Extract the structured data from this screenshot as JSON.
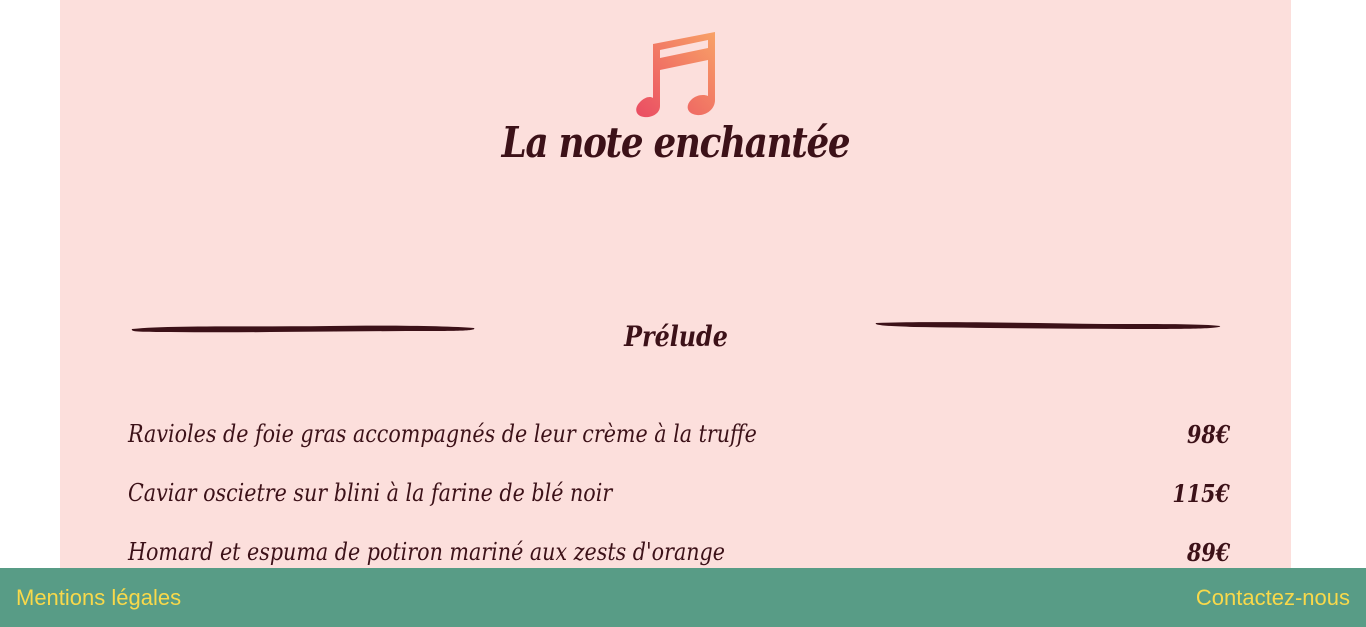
{
  "header": {
    "logo_icon": "music-note-icon",
    "title": "La note enchantée"
  },
  "menu": {
    "section_title": "Prélude",
    "items": [
      {
        "name": "Ravioles de foie gras accompagnés de leur crème à la truffe",
        "price": "98€"
      },
      {
        "name": "Caviar oscietre sur blini à la farine de blé noir",
        "price": "115€"
      },
      {
        "name": "Homard et espuma de potiron mariné aux zests d'orange",
        "price": "89€"
      }
    ]
  },
  "footer": {
    "legal_link": "Mentions légales",
    "contact_link": "Contactez-nous"
  },
  "colors": {
    "background": "#fcdfdc",
    "text": "#3c1118",
    "footer": "#589c86",
    "footer_link": "#f9d94a",
    "logo_gradient_start": "#ea4c63",
    "logo_gradient_end": "#f8a266"
  }
}
